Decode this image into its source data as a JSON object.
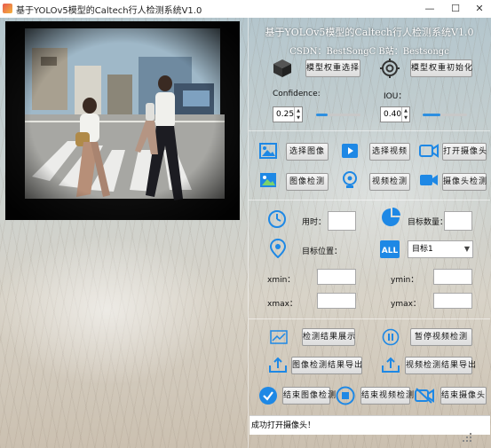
{
  "window": {
    "title": "基于YOLOv5模型的Caltech行人检测系统V1.0",
    "controls": {
      "minimize": "—",
      "maximize": "☐",
      "close": "✕"
    }
  },
  "header": {
    "title": "基于YOLOv5模型的Caltech行人检测系统V1.0",
    "subtitle": "CSDN：BestSongC   B站：Bestsongc"
  },
  "model": {
    "select_label": "模型权重选择",
    "init_label": "模型权重初始化"
  },
  "params": {
    "confidence_label": "Confidence:",
    "confidence_value": "0.25",
    "confidence_fraction": 0.25,
    "iou_label": "IOU：",
    "iou_value": "0.40",
    "iou_fraction": 0.4
  },
  "input_buttons": {
    "select_image": "选择图像",
    "select_video": "选择视频",
    "open_camera": "打开摄像头",
    "image_detect": "图像检测",
    "video_detect": "视频检测",
    "camera_detect": "摄像头检测"
  },
  "results": {
    "time_label": "用时：",
    "time_value": "",
    "count_label": "目标数量：",
    "count_value": "",
    "position_label": "目标位置：",
    "target_selected": "目标1",
    "xmin_label": "xmin：",
    "ymin_label": "ymin：",
    "xmax_label": "xmax：",
    "ymax_label": "ymax："
  },
  "actions": {
    "show_results": "检测结果展示",
    "pause_video": "暂停视频检测",
    "export_image": "图像检测结果导出",
    "export_video": "视频检测结果导出",
    "end_image": "结束图像检测",
    "end_video": "结束视频检测",
    "end_camera": "结束摄像头"
  },
  "status": {
    "message": "成功打开摄像头！"
  },
  "colors": {
    "accent": "#2d8fe0",
    "icon_blue": "#1e88e5"
  }
}
